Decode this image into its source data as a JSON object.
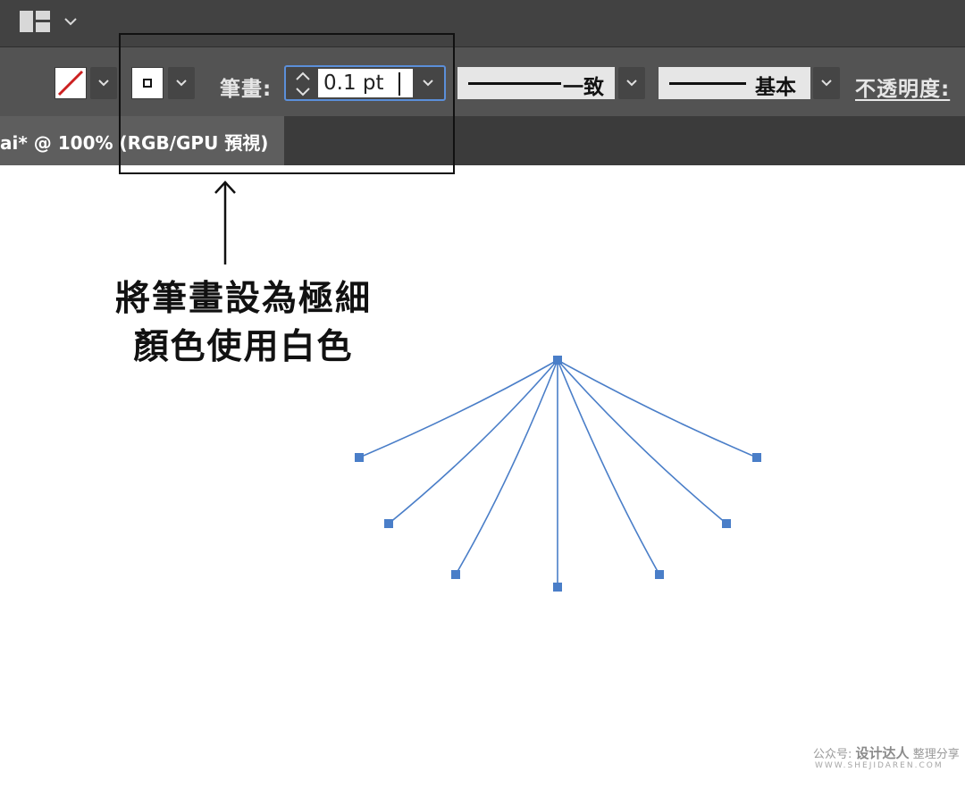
{
  "toolbar": {
    "stroke_label": "筆畫:",
    "stroke_value": "0.1 pt",
    "profile_label": "一致",
    "brush_label": "基本",
    "opacity_label": "不透明度:"
  },
  "document_tab": {
    "title": "ai* @ 100% (RGB/GPU 預視)"
  },
  "annotation": {
    "line1": "將筆畫設為極細",
    "line2": "顏色使用白色"
  },
  "watermark": {
    "brand_prefix": "公众号:",
    "brand_name": "设计达人",
    "brand_suffix": "整理分享",
    "url": "WWW.SHEJIDAREN.COM"
  },
  "colors": {
    "ui_dark": "#424242",
    "ui_control": "#535353",
    "focus_blue": "#5b8fd9",
    "path_blue": "#4a7ec8",
    "fill_none_red": "#cc2020"
  },
  "icons": {
    "workspace": "workspace-layout-icon",
    "fill_swatch": "fill-none-swatch-icon",
    "stroke_swatch": "stroke-swatch-icon",
    "spinner": "stepper-arrows-icon",
    "dropdown": "chevron-down-icon"
  }
}
